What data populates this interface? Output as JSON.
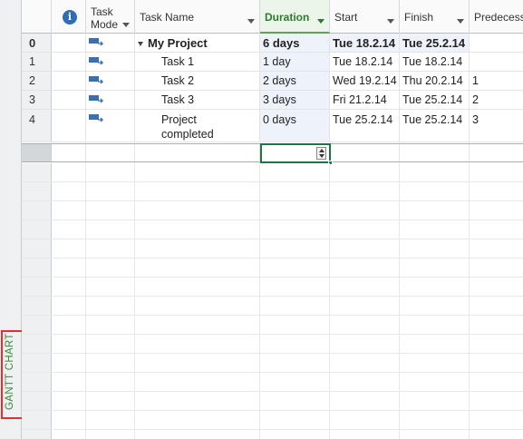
{
  "view_bar": {
    "label": "GANTT CHART"
  },
  "columns": {
    "task_mode": "Task Mode",
    "task_name": "Task Name",
    "duration": "Duration",
    "start": "Start",
    "finish": "Finish",
    "predecessors": "Predecesso"
  },
  "tasks": [
    {
      "id": "0",
      "name": "My Project",
      "duration": "6 days",
      "start": "Tue 18.2.14",
      "finish": "Tue 25.2.14",
      "predecessors": "",
      "summary": true
    },
    {
      "id": "1",
      "name": "Task 1",
      "duration": "1 day",
      "start": "Tue 18.2.14",
      "finish": "Tue 18.2.14",
      "predecessors": ""
    },
    {
      "id": "2",
      "name": "Task 2",
      "duration": "2 days",
      "start": "Wed 19.2.14",
      "finish": "Thu 20.2.14",
      "predecessors": "1"
    },
    {
      "id": "3",
      "name": "Task 3",
      "duration": "3 days",
      "start": "Fri 21.2.14",
      "finish": "Tue 25.2.14",
      "predecessors": "2"
    },
    {
      "id": "4",
      "name": "Project completed",
      "duration": "0 days",
      "start": "Tue 25.2.14",
      "finish": "Tue 25.2.14",
      "predecessors": "3"
    }
  ],
  "colors": {
    "accent_green": "#2d7a2d",
    "duration_header_bg": "#ebf5e9",
    "view_label_highlight": "#e03030",
    "task_mode_icon": "#3a6fb0"
  },
  "icons": {
    "info": "info-icon",
    "task_mode": "auto-scheduled-task-icon"
  }
}
